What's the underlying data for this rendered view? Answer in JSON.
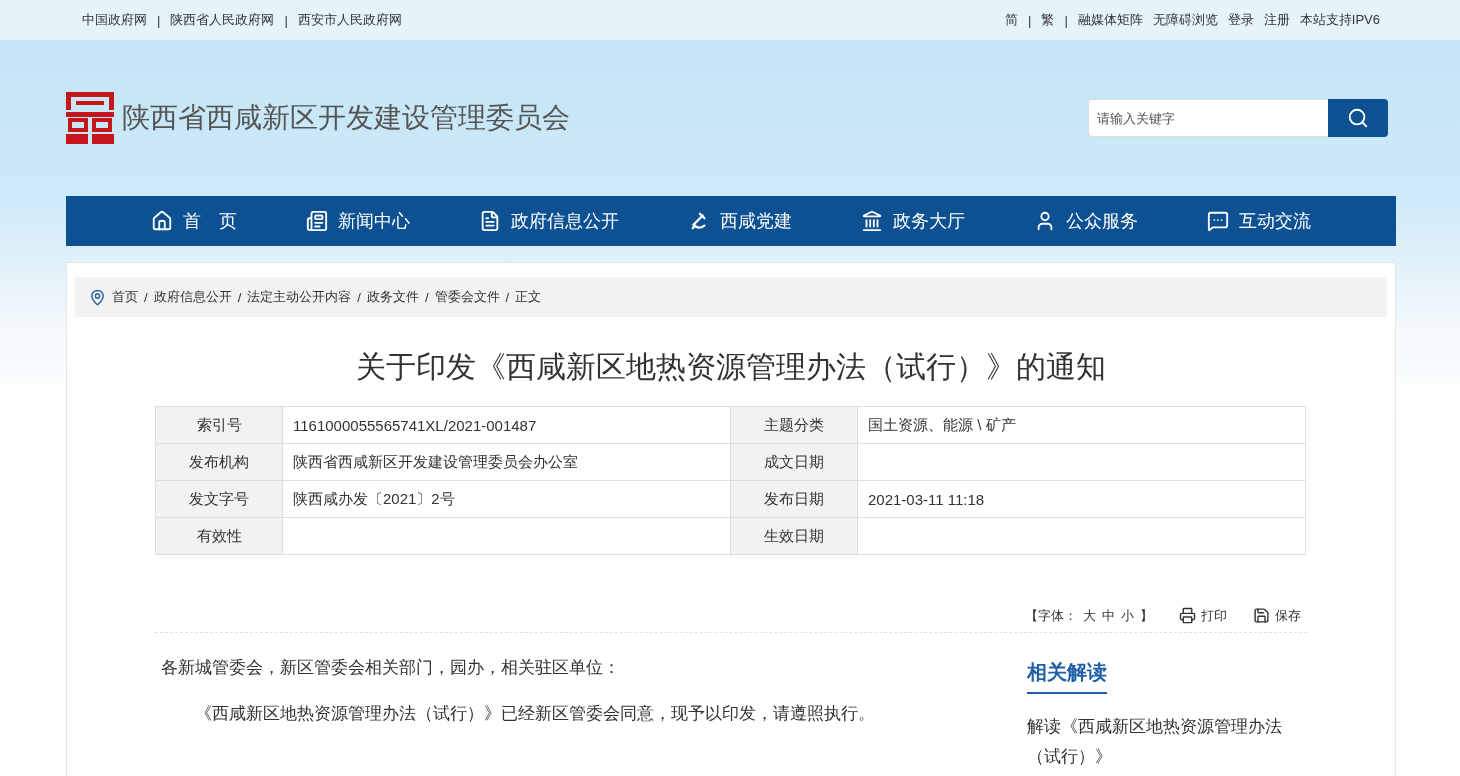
{
  "top_bar": {
    "left_links": [
      {
        "label": "中国政府网",
        "separator": "|"
      },
      {
        "label": "陕西省人民政府网",
        "separator": "|"
      },
      {
        "label": "西安市人民政府网"
      }
    ],
    "right_links": [
      {
        "label": "简",
        "separator": "|"
      },
      {
        "label": "繁",
        "separator": "|"
      },
      {
        "label": "融媒体矩阵"
      },
      {
        "label": "无障碍浏览"
      },
      {
        "label": "登录"
      },
      {
        "label": "注册"
      },
      {
        "label": "本站支持IPV6"
      }
    ]
  },
  "header": {
    "site_name": "陕西省西咸新区开发建设管理委员会",
    "search": {
      "placeholder": "请输入关键字"
    }
  },
  "nav": [
    {
      "label": "首　页"
    },
    {
      "label": "新闻中心"
    },
    {
      "label": "政府信息公开"
    },
    {
      "label": "西咸党建"
    },
    {
      "label": "政务大厅"
    },
    {
      "label": "公众服务"
    },
    {
      "label": "互动交流"
    }
  ],
  "breadcrumb": [
    {
      "label": "首页",
      "separator": "/"
    },
    {
      "label": "政府信息公开",
      "separator": "/"
    },
    {
      "label": "法定主动公开内容",
      "separator": "/"
    },
    {
      "label": "政务文件",
      "separator": "/"
    },
    {
      "label": "管委会文件",
      "separator": "/"
    },
    {
      "label": "正文"
    }
  ],
  "article": {
    "title": "关于印发《西咸新区地热资源管理办法（试行）》的通知",
    "info_table": [
      [
        {
          "label": "索引号",
          "value": "1161000055565741XL/2021-001487"
        },
        {
          "label": "主题分类",
          "value": "国土资源、能源 \\ 矿产"
        }
      ],
      [
        {
          "label": "发布机构",
          "value": "陕西省西咸新区开发建设管理委员会办公室"
        },
        {
          "label": "成文日期"
        }
      ],
      [
        {
          "label": "发文字号",
          "value": "陕西咸办发〔2021〕2号"
        },
        {
          "label": "发布日期",
          "value": "2021-03-11 11:18"
        }
      ],
      [
        {
          "label": "有效性"
        },
        {
          "label": "生效日期"
        }
      ]
    ],
    "tools": {
      "font_label": "【字体：",
      "font_sizes": [
        "大",
        "中",
        "小"
      ],
      "font_close": "】",
      "print": "打印",
      "save": "保存"
    },
    "body": [
      "各新城管委会，新区管委会相关部门，园办，相关驻区单位：",
      "《西咸新区地热资源管理办法（试行）》已经新区管委会同意，现予以印发，请遵照执行。"
    ]
  },
  "related": {
    "title": "相关解读",
    "items": [
      "解读《西咸新区地热资源管理办法（试行）》"
    ]
  }
}
